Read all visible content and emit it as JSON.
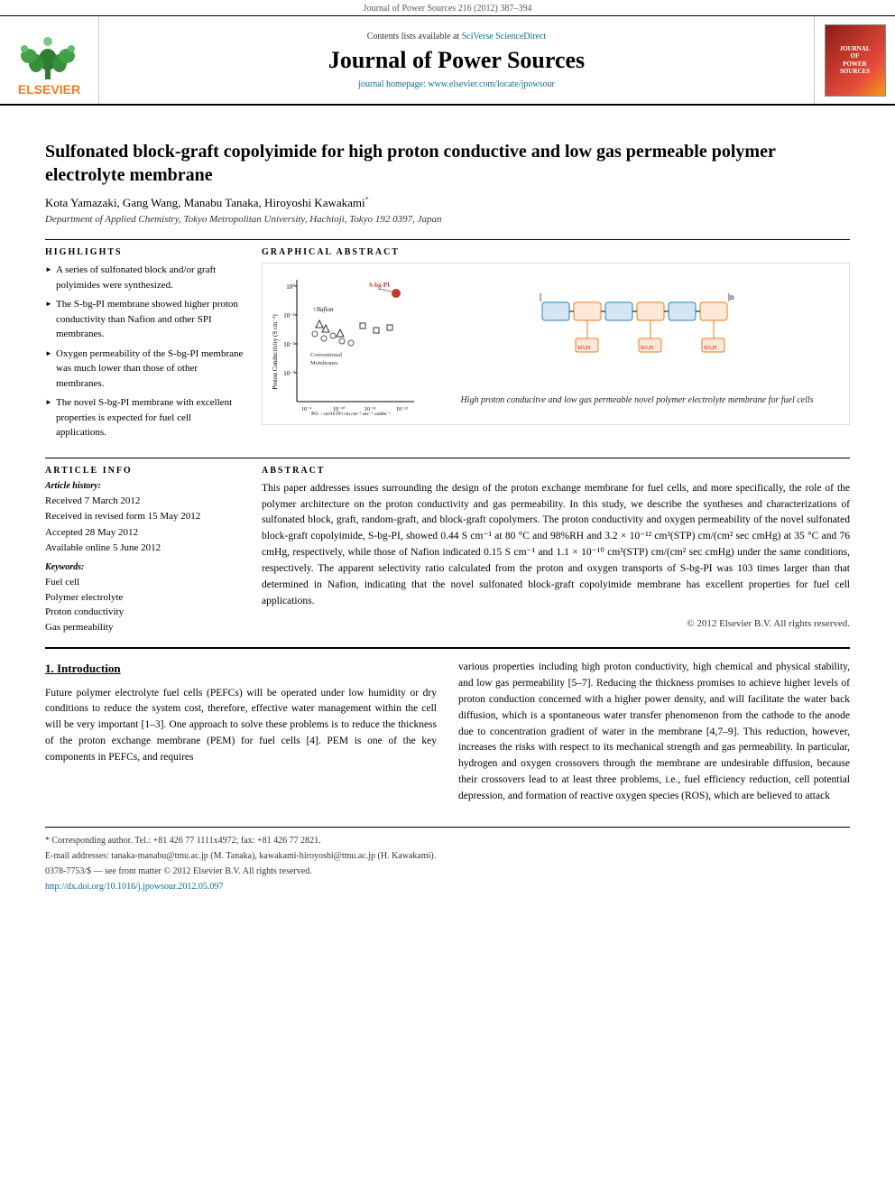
{
  "journal_ref": "Journal of Power Sources 216 (2012) 387–394",
  "header": {
    "sciverse_text": "Contents lists available at",
    "sciverse_link_label": "SciVerse ScienceDirect",
    "journal_title": "Journal of Power Sources",
    "homepage_text": "journal homepage: www.elsevier.com/locate/jpowsour"
  },
  "article": {
    "title": "Sulfonated block-graft copolyimide for high proton conductive and low gas permeable polymer electrolyte membrane",
    "authors": "Kota Yamazaki, Gang Wang, Manabu Tanaka, Hiroyoshi Kawakami*",
    "affiliation": "Department of Applied Chemistry, Tokyo Metropolitan University, Hachioji, Tokyo 192 0397, Japan"
  },
  "highlights": {
    "label": "Highlights",
    "items": [
      "A series of sulfonated block and/or graft polyimides were synthesized.",
      "The S-bg-PI membrane showed higher proton conductivity than Nafion and other SPI membranes.",
      "Oxygen permeability of the S-bg-PI membrane was much lower than those of other membranes.",
      "The novel S-bg-PI membrane with excellent properties is expected for fuel cell applications."
    ]
  },
  "graphical_abstract": {
    "label": "Graphical Abstract",
    "polymer_label": "S-bg-PI",
    "chart_y_label": "Proton Conductivity (S cm⁻¹)",
    "chart_x_label": "PO₂ / cm²(STP) cm cm⁻² sec⁻¹ cmHg⁻¹",
    "caption": "High proton conducitve and low gas permeable novel polymer electrolyte membrane for fuel cells",
    "conventional_label": "Conventional Membranes",
    "nafion_label": "Nafion"
  },
  "article_info": {
    "label": "Article Info",
    "history_label": "Article history:",
    "received": "Received 7 March 2012",
    "revised": "Received in revised form 15 May 2012",
    "accepted": "Accepted 28 May 2012",
    "available": "Available online 5 June 2012",
    "keywords_label": "Keywords:",
    "keywords": [
      "Fuel cell",
      "Polymer electrolyte",
      "Proton conductivity",
      "Gas permeability"
    ]
  },
  "abstract": {
    "label": "Abstract",
    "text": "This paper addresses issues surrounding the design of the proton exchange membrane for fuel cells, and more specifically, the role of the polymer architecture on the proton conductivity and gas permeability. In this study, we describe the syntheses and characterizations of sulfonated block, graft, random-graft, and block-graft copolymers. The proton conductivity and oxygen permeability of the novel sulfonated block-graft copolyimide, S-bg-PI, showed 0.44 S cm⁻¹ at 80 °C and 98%RH and 3.2 × 10⁻¹² cm³(STP) cm/(cm² sec cmHg) at 35 °C and 76 cmHg, respectively, while those of Nafion indicated 0.15 S cm⁻¹ and 1.1 × 10⁻¹⁰ cm³(STP) cm/(cm² sec cmHg) under the same conditions, respectively. The apparent selectivity ratio calculated from the proton and oxygen transports of S-bg-PI was 103 times larger than that determined in Nafion, indicating that the novel sulfonated block-graft copolyimide membrane has excellent properties for fuel cell applications.",
    "copyright": "© 2012 Elsevier B.V. All rights reserved."
  },
  "introduction": {
    "section_number": "1.",
    "section_title": "Introduction",
    "paragraph1": "Future polymer electrolyte fuel cells (PEFCs) will be operated under low humidity or dry conditions to reduce the system cost, therefore, effective water management within the cell will be very important [1–3]. One approach to solve these problems is to reduce the thickness of the proton exchange membrane (PEM) for fuel cells [4]. PEM is one of the key components in PEFCs, and requires",
    "paragraph2_right": "various properties including high proton conductivity, high chemical and physical stability, and low gas permeability [5–7]. Reducing the thickness promises to achieve higher levels of proton conduction concerned with a higher power density, and will facilitate the water back diffusion, which is a spontaneous water transfer phenomenon from the cathode to the anode due to concentration gradient of water in the membrane [4,7–9]. This reduction, however, increases the risks with respect to its mechanical strength and gas permeability. In particular, hydrogen and oxygen crossovers through the membrane are undesirable diffusion, because their crossovers lead to at least three problems, i.e., fuel efficiency reduction, cell potential depression, and formation of reactive oxygen species (ROS), which are believed to attack"
  },
  "footer": {
    "corresponding_note": "* Corresponding author. Tel.: +81 426 77 1111x4972; fax: +81 426 77 2821.",
    "email_note": "E-mail addresses: tanaka-manabu@tmu.ac.jp (M. Tanaka), kawakami-hiroyoshi@tmu.ac.jp (H. Kawakami).",
    "issn": "0378-7753/$ — see front matter © 2012 Elsevier B.V. All rights reserved.",
    "doi": "http://dx.doi.org/10.1016/j.jpowsour.2012.05.097"
  }
}
